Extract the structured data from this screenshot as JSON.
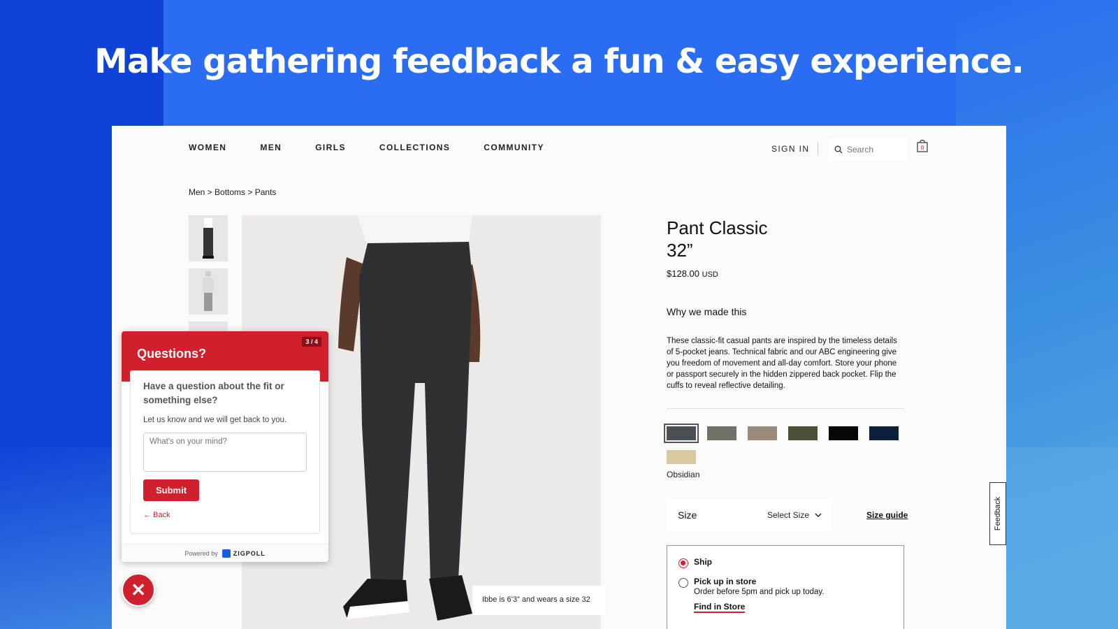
{
  "headline": "Make gathering feedback a fun & easy experience.",
  "nav": {
    "items": [
      "WOMEN",
      "MEN",
      "GIRLS",
      "COLLECTIONS",
      "COMMUNITY"
    ],
    "sign_in": "SIGN IN",
    "search_placeholder": "Search",
    "bag_count": "0"
  },
  "breadcrumb": "Men > Bottoms > Pants",
  "product": {
    "title_line1": "Pant Classic",
    "title_line2": "32”",
    "price": "$128.00",
    "currency": "USD",
    "why_heading": "Why we made this",
    "description": "These classic-fit casual pants are inspired by the timeless details of 5-pocket jeans. Technical fabric and our ABC engineering give you freedom of movement and all-day comfort. Store your phone or passport securely in the hidden zippered back pocket. Flip the cuffs to reveal reflective detailing.",
    "swatches": [
      "#4a4e55",
      "#6f7266",
      "#9b8a7a",
      "#4a5235",
      "#050505",
      "#0e1f3a",
      "#d8c9a0"
    ],
    "selected_color": "Obsidian",
    "size_label": "Size",
    "size_select": "Select Size",
    "size_guide": "Size guide",
    "ship_label": "Ship",
    "pickup_label": "Pick up in store",
    "pickup_sub": "Order before 5pm and pick up today.",
    "find_store": "Find in Store",
    "caption": "Ibbe is 6’3” and wears a size 32"
  },
  "feedback_tab": "Feedback",
  "widget": {
    "title": "Questions?",
    "step": "3 / 4",
    "question": "Have a question about the fit or something else?",
    "subtext": "Let us know and we will get back to you.",
    "textarea_placeholder": "What's on your mind?",
    "submit_label": "Submit",
    "back_label": "← Back",
    "powered_by": "Powered by",
    "brand": "ZIGPOLL",
    "close_glyph": "✕"
  },
  "colors": {
    "accent": "#d0202e",
    "background": "#1a4fe0"
  }
}
